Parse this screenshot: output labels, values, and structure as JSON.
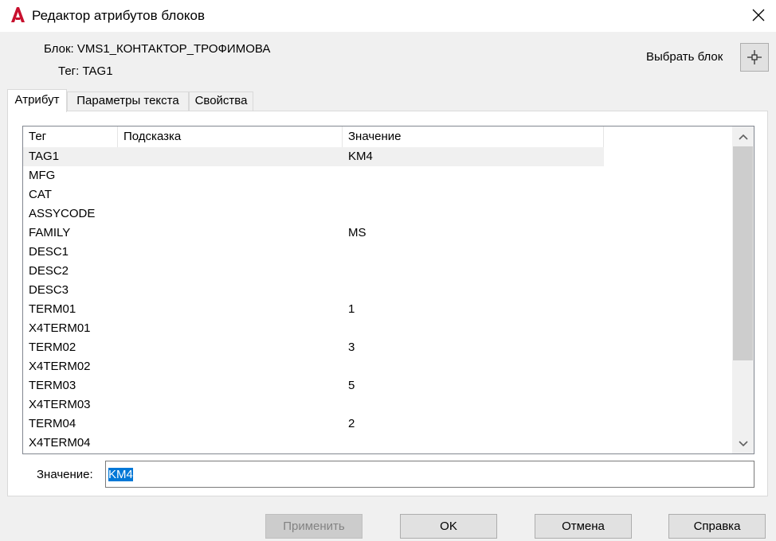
{
  "window": {
    "title": "Редактор атрибутов блоков",
    "app_icon": "autocad-a-icon",
    "close_icon": "close-icon"
  },
  "block_info": {
    "block_line": "Блок: VMS1_КОНТАКТОР_ТРОФИМОВА",
    "tag_line": "Тег: TAG1"
  },
  "select_block": {
    "label": "Выбрать блок",
    "icon": "crosshair-pick-icon"
  },
  "tabs": [
    {
      "label": "Атрибут",
      "active": true
    },
    {
      "label": "Параметры текста",
      "active": false
    },
    {
      "label": "Свойства",
      "active": false
    }
  ],
  "grid": {
    "columns": [
      "Тег",
      "Подсказка",
      "Значение"
    ],
    "rows": [
      {
        "tag": "TAG1",
        "prompt": "",
        "value": "KM4"
      },
      {
        "tag": "MFG",
        "prompt": "",
        "value": ""
      },
      {
        "tag": "CAT",
        "prompt": "",
        "value": ""
      },
      {
        "tag": "ASSYCODE",
        "prompt": "",
        "value": ""
      },
      {
        "tag": "FAMILY",
        "prompt": "",
        "value": "MS"
      },
      {
        "tag": "DESC1",
        "prompt": "",
        "value": ""
      },
      {
        "tag": "DESC2",
        "prompt": "",
        "value": ""
      },
      {
        "tag": "DESC3",
        "prompt": "",
        "value": ""
      },
      {
        "tag": "TERM01",
        "prompt": "",
        "value": "1"
      },
      {
        "tag": "X4TERM01",
        "prompt": "",
        "value": ""
      },
      {
        "tag": "TERM02",
        "prompt": "",
        "value": "3"
      },
      {
        "tag": "X4TERM02",
        "prompt": "",
        "value": ""
      },
      {
        "tag": "TERM03",
        "prompt": "",
        "value": "5"
      },
      {
        "tag": "X4TERM03",
        "prompt": "",
        "value": ""
      },
      {
        "tag": "TERM04",
        "prompt": "",
        "value": "2"
      },
      {
        "tag": "X4TERM04",
        "prompt": "",
        "value": ""
      }
    ],
    "selected_row": 0
  },
  "value_field": {
    "label": "Значение:",
    "value": "KM4"
  },
  "buttons": {
    "apply": "Применить",
    "ok": "OK",
    "cancel": "Отмена",
    "help": "Справка"
  },
  "colors": {
    "selection": "#0078d7",
    "row_highlight": "#f0f0f0",
    "app_icon_red": "#c8102e"
  }
}
